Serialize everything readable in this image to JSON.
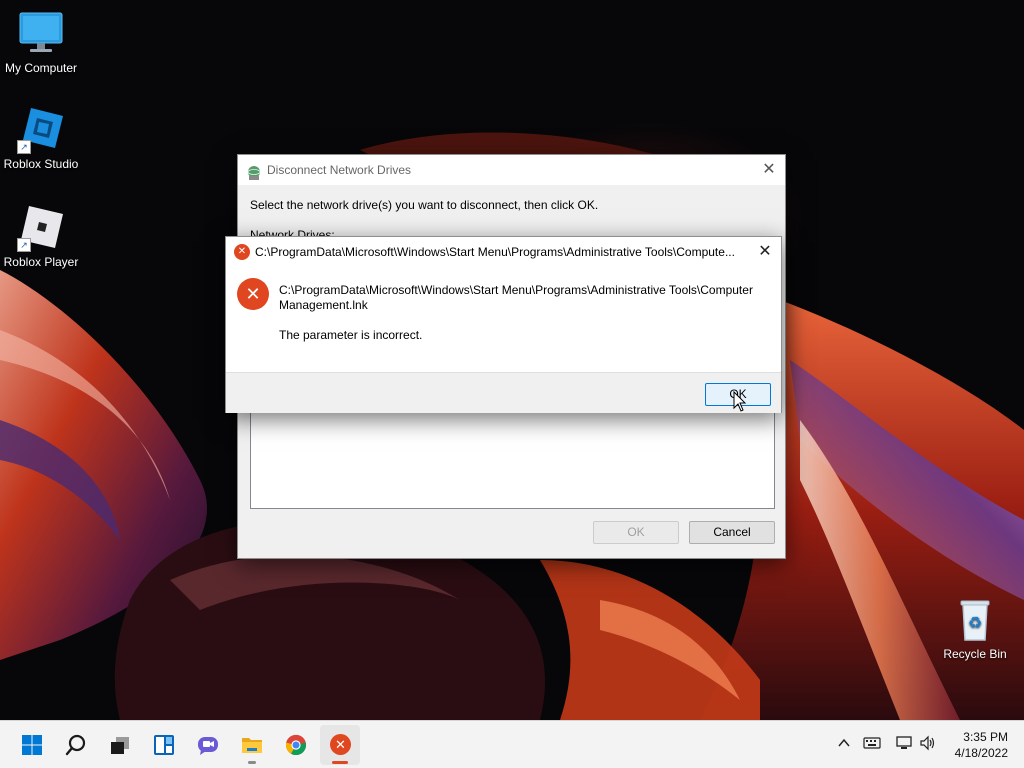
{
  "desktop": {
    "icons": [
      {
        "label": "My Computer",
        "icon": "monitor-icon"
      },
      {
        "label": "Roblox Studio",
        "icon": "roblox-studio-icon"
      },
      {
        "label": "Roblox Player",
        "icon": "roblox-player-icon"
      },
      {
        "label": "Recycle Bin",
        "icon": "recycle-bin-icon"
      }
    ]
  },
  "disconnect_dialog": {
    "title": "Disconnect Network Drives",
    "instruction": "Select the network drive(s) you want to disconnect, then click OK.",
    "list_label": "Network Drives:",
    "ok_label": "OK",
    "cancel_label": "Cancel"
  },
  "error_dialog": {
    "title": "C:\\ProgramData\\Microsoft\\Windows\\Start Menu\\Programs\\Administrative Tools\\Compute...",
    "path_line1": "C:\\ProgramData\\Microsoft\\Windows\\Start Menu\\Programs\\Administrative Tools\\Computer",
    "path_line2": "Management.lnk",
    "message": "The parameter is incorrect.",
    "ok_label": "OK",
    "icon": "error-icon"
  },
  "taskbar": {
    "items": [
      {
        "name": "start",
        "icon": "windows-start-icon"
      },
      {
        "name": "search",
        "icon": "search-icon"
      },
      {
        "name": "task-view",
        "icon": "task-view-icon"
      },
      {
        "name": "widgets",
        "icon": "widgets-icon"
      },
      {
        "name": "chat",
        "icon": "chat-icon"
      },
      {
        "name": "file-explorer",
        "icon": "folder-icon"
      },
      {
        "name": "chrome",
        "icon": "chrome-icon"
      },
      {
        "name": "error-app",
        "icon": "error-icon"
      }
    ],
    "tray": [
      "chevron-up-icon",
      "keyboard-icon",
      "network-icon",
      "volume-icon"
    ],
    "time": "3:35 PM",
    "date": "4/18/2022"
  },
  "colors": {
    "accent": "#0078d7",
    "error": "#e0461f",
    "taskbar": "#f3f3f3"
  }
}
